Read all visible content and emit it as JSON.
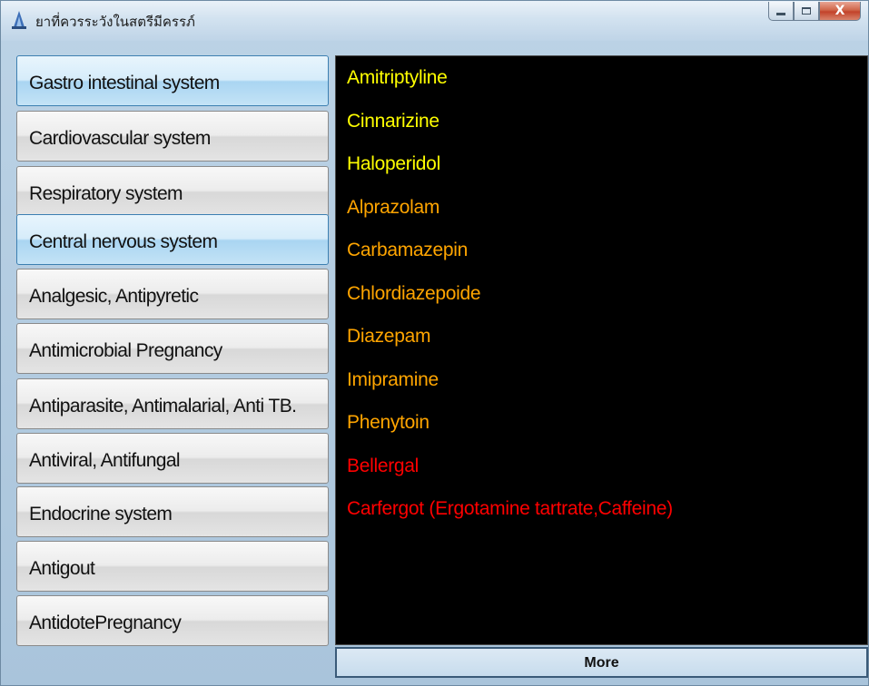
{
  "window": {
    "title": "ยาที่ควรระวังในสตรีมีครรภ์",
    "app_icon": "app-icon",
    "controls": {
      "minimize": "minimize-icon",
      "maximize": "maximize-icon",
      "close_label": "X"
    }
  },
  "categories": [
    {
      "label": "Gastro intestinal system",
      "active": true
    },
    {
      "label": "Cardiovascular system",
      "active": false
    },
    {
      "label": "Respiratory system",
      "active": false
    },
    {
      "label": "Central nervous system",
      "active": true
    },
    {
      "label": "Analgesic, Antipyretic",
      "active": false
    },
    {
      "label": "Antimicrobial Pregnancy",
      "active": false
    },
    {
      "label": "Antiparasite, Antimalarial, Anti TB.",
      "active": false
    },
    {
      "label": " Antiviral, Antifungal",
      "active": false
    },
    {
      "label": "Endocrine system",
      "active": false
    },
    {
      "label": " Antigout",
      "active": false
    },
    {
      "label": "AntidotePregnancy",
      "active": false
    }
  ],
  "drugs": [
    {
      "name": "Amitriptyline",
      "color": "#ffff00"
    },
    {
      "name": "Cinnarizine",
      "color": "#ffff00"
    },
    {
      "name": "Haloperidol",
      "color": "#ffff00"
    },
    {
      "name": "Alprazolam",
      "color": "#ffa500"
    },
    {
      "name": "Carbamazepin",
      "color": "#ffa500"
    },
    {
      "name": "Chlordiazepoide",
      "color": "#ffa500"
    },
    {
      "name": "Diazepam",
      "color": "#ffa500"
    },
    {
      "name": "Imipramine",
      "color": "#ffa500"
    },
    {
      "name": "Phenytoin",
      "color": "#ffa500"
    },
    {
      "name": "Bellergal",
      "color": "#ff0000"
    },
    {
      "name": "Carfergot (Ergotamine tartrate,Caffeine)",
      "color": "#ff0000"
    }
  ],
  "more_button": {
    "label": "More"
  }
}
